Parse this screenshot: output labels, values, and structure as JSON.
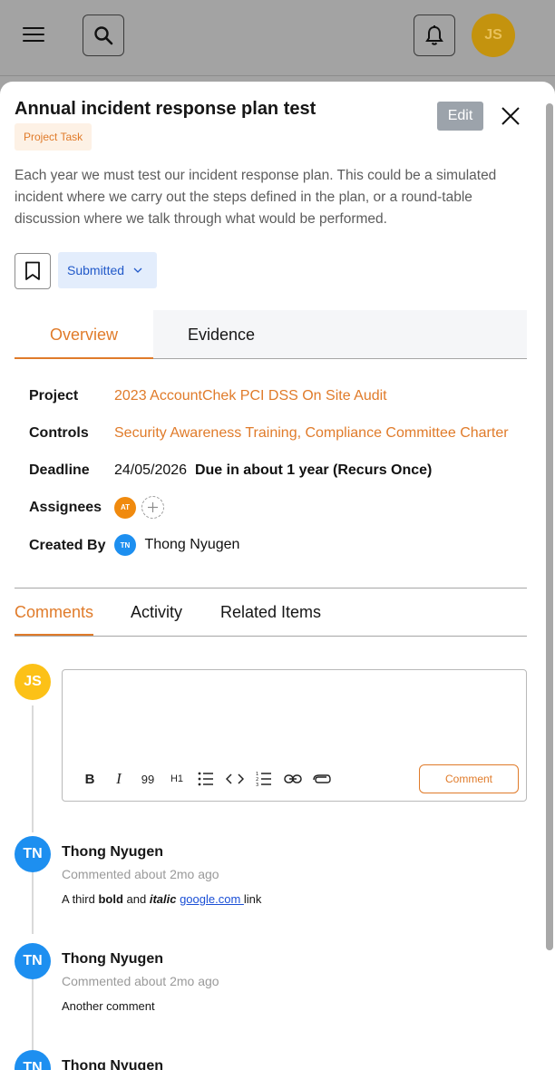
{
  "header": {
    "user_initials": "JS"
  },
  "task": {
    "title": "Annual incident response plan test",
    "tag": "Project Task",
    "edit_label": "Edit",
    "description": "Each year we must test our incident response plan. This could be a simulated incident where we carry out the steps defined in the plan, or a round-table discussion where we talk through what would be performed.",
    "status": "Submitted"
  },
  "main_tabs": [
    {
      "label": "Overview",
      "active": true
    },
    {
      "label": "Evidence",
      "active": false
    }
  ],
  "details": {
    "project_label": "Project",
    "project_value": "2023 AccountChek PCI DSS On Site Audit",
    "controls_label": "Controls",
    "controls_value": "Security Awareness Training, Compliance Committee Charter",
    "deadline_label": "Deadline",
    "deadline_date": "24/05/2026",
    "deadline_note": "Due in about 1 year (Recurs Once)",
    "assignees_label": "Assignees",
    "assignee_initials": "AT",
    "created_by_label": "Created By",
    "creator_initials": "TN",
    "creator_name": "Thong Nyugen"
  },
  "sub_tabs": [
    {
      "label": "Comments",
      "active": true
    },
    {
      "label": "Activity",
      "active": false
    },
    {
      "label": "Related Items",
      "active": false
    }
  ],
  "composer": {
    "user_initials": "JS",
    "comment_button": "Comment",
    "tools": [
      "B",
      "I",
      "99",
      "H1"
    ]
  },
  "comments": [
    {
      "initials": "TN",
      "author": "Thong Nyugen",
      "meta": "Commented about 2mo ago",
      "body_a": "A third ",
      "body_bold": "bold",
      "body_b": " and ",
      "body_italic": "italic",
      "body_c": " ",
      "body_link": "google.com ",
      "body_d": "link"
    },
    {
      "initials": "TN",
      "author": "Thong Nyugen",
      "meta": "Commented about 2mo ago",
      "body": "Another comment"
    },
    {
      "initials": "TN",
      "author": "Thong Nyugen"
    }
  ],
  "colors": {
    "accent": "#e07b2a",
    "status_bg": "#e3edfc",
    "status_text": "#2159c9",
    "avatar_tn": "#1d8ff0",
    "avatar_js": "#fcc117"
  }
}
